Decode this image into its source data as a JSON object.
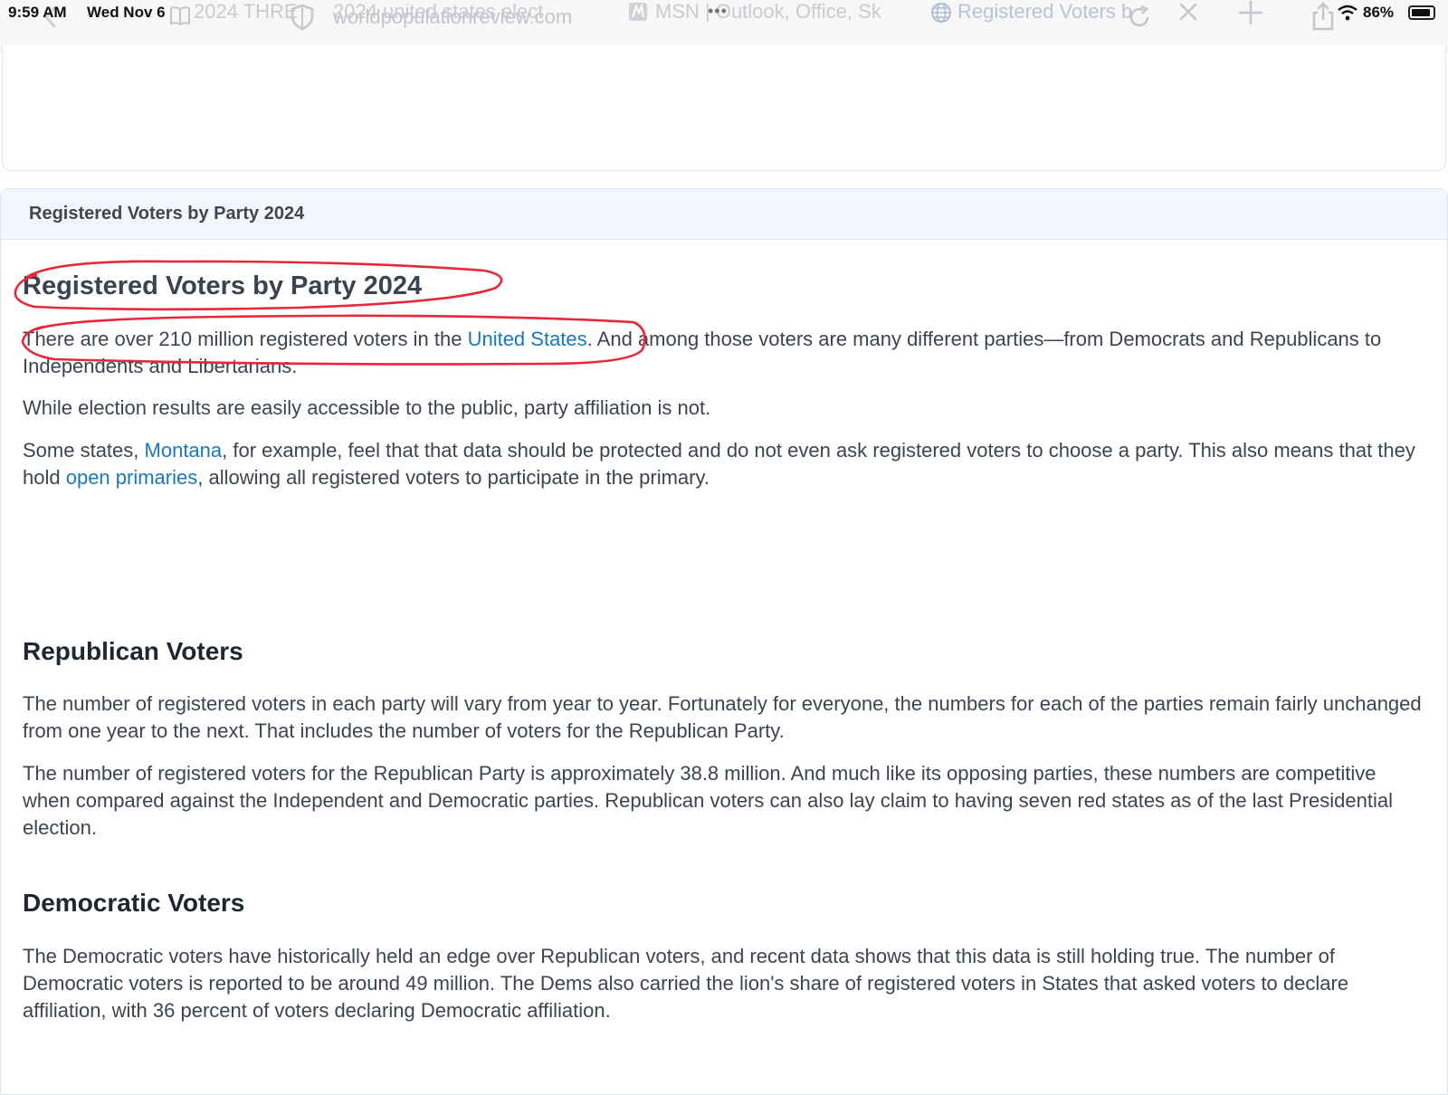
{
  "status_bar": {
    "time": "9:59 AM",
    "date": "Wed Nov 6",
    "battery": "86%"
  },
  "tabs": {
    "tab1_fragment": "2024 THRE",
    "url": "worldpopulationreview.com",
    "url_overlay": "2024 united states elect",
    "tab2": "MSN | Outlook, Office, Sk",
    "tab3": "Registered Voters b",
    "dots": "•••"
  },
  "section_header": "Registered Voters by Party 2024",
  "article": {
    "title": "Registered Voters by Party 2024",
    "intro": {
      "before_link": "There are over 210 million registered voters in the ",
      "link": "United States",
      "after_link": ". And among those voters are many different parties—from Democrats and Republicans to Independents and Libertarians."
    },
    "p2": "While election results are easily accessible to the public, party affiliation is not.",
    "p3": {
      "part1": "Some states, ",
      "link1": "Montana",
      "part2": ", for example, feel that that data should be protected and do not even ask registered voters to choose a party. This also means that they hold ",
      "link2": "open primaries",
      "part3": ", allowing all registered voters to participate in the primary."
    },
    "republican": {
      "heading": "Republican Voters",
      "p1": "The number of registered voters in each party will vary from year to year. Fortunately for everyone, the numbers for each of the parties remain fairly unchanged from one year to the next. That includes the number of voters for the Republican Party.",
      "p2": "The number of registered voters for the Republican Party is approximately 38.8 million. And much like its opposing parties, these numbers are competitive when compared against the Independent and Democratic parties. Republican voters can also lay claim to having seven red states as of the last Presidential election."
    },
    "democratic": {
      "heading": "Democratic Voters",
      "p1": "The Democratic voters have historically held an edge over Republican voters, and recent data shows that this data is still holding true. The number of Democratic voters is reported to be around 49 million. The Dems also carried the lion's share of registered voters in States that asked voters to declare affiliation, with 36 percent of voters declaring Democratic affiliation."
    }
  },
  "colors": {
    "link": "#1a78b9",
    "annotation": "#e8283a",
    "header_bg": "#f1f7fd"
  },
  "icons": [
    "back-chevron-icon",
    "book-icon",
    "shield-icon",
    "msn-icon",
    "globe-icon",
    "reload-icon",
    "close-tab-icon",
    "new-tab-icon",
    "share-icon",
    "wifi-icon",
    "battery-icon"
  ]
}
